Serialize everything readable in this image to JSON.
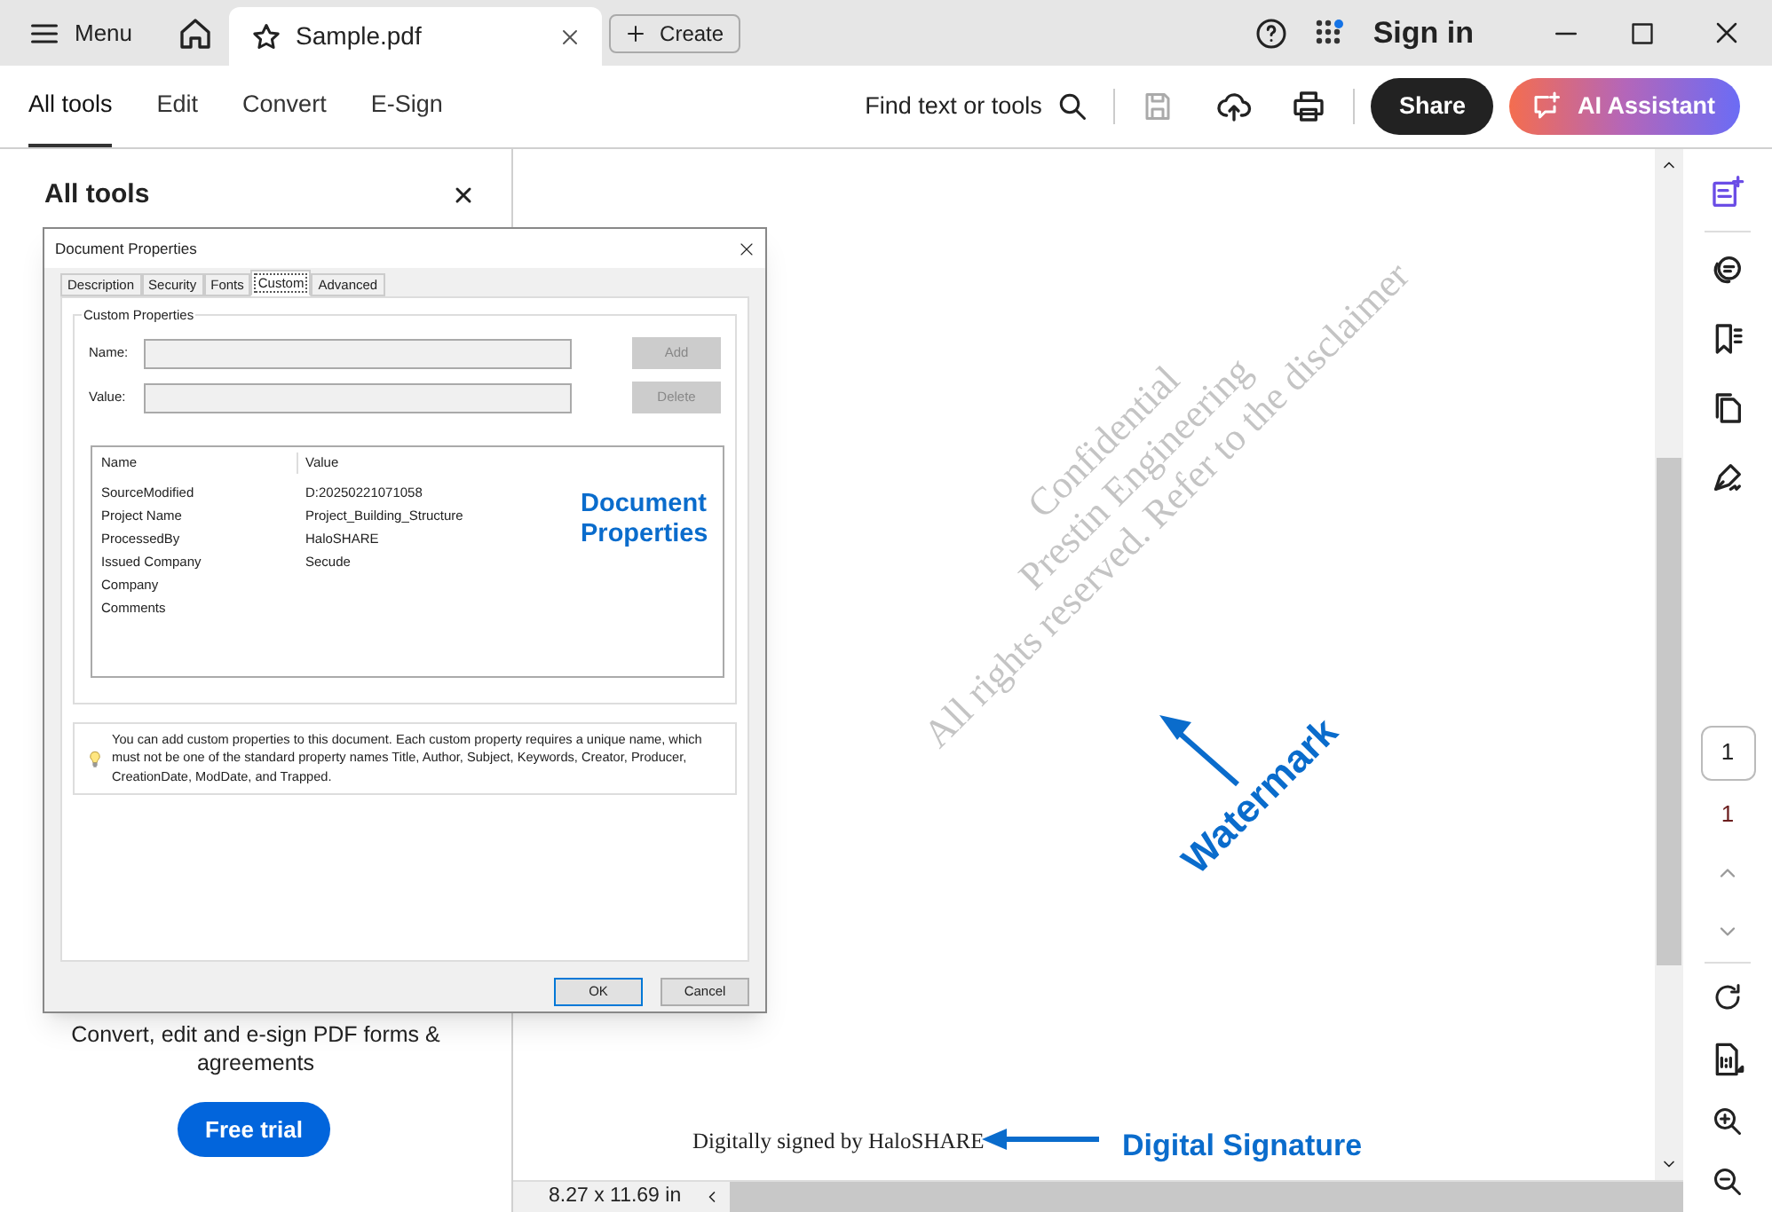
{
  "title_bar": {
    "menu_label": "Menu",
    "tab": {
      "title": "Sample.pdf",
      "selected": true
    },
    "create_label": "Create",
    "sign_in": "Sign in"
  },
  "toolbar": {
    "tabs": [
      {
        "label": "All tools",
        "selected": true
      },
      {
        "label": "Edit",
        "selected": false
      },
      {
        "label": "Convert",
        "selected": false
      },
      {
        "label": "E-Sign",
        "selected": false
      }
    ],
    "search_label": "Find text or tools",
    "save_disabled": true,
    "share_label": "Share",
    "ai_label": "AI Assistant"
  },
  "left_panel": {
    "title": "All tools",
    "promo": "Convert, edit and e-sign PDF forms & agreements",
    "button": "Free trial"
  },
  "dialog": {
    "title": "Document Properties",
    "tabs": [
      {
        "label": "Description",
        "selected": false
      },
      {
        "label": "Security",
        "selected": false
      },
      {
        "label": "Fonts",
        "selected": false
      },
      {
        "label": "Custom",
        "selected": true
      },
      {
        "label": "Advanced",
        "selected": false
      }
    ],
    "group_title": "Custom Properties",
    "name_label": "Name:",
    "value_label": "Value:",
    "add": "Add",
    "delete": "Delete",
    "buttons_disabled": true,
    "list": {
      "columns": [
        "Name",
        "Value"
      ],
      "rows": [
        {
          "name": "SourceModified",
          "value": "D:20250221071058"
        },
        {
          "name": "Project Name",
          "value": "Project_Building_Structure"
        },
        {
          "name": "ProcessedBy",
          "value": "HaloSHARE"
        },
        {
          "name": "Issued Company",
          "value": "Secude"
        },
        {
          "name": "Company"
        },
        {
          "name": "Comments"
        }
      ]
    },
    "info": "You can add custom properties to this document. Each custom property requires a unique name, which must not be one of the standard property names Title, Author, Subject, Keywords, Creator, Producer, CreationDate, ModDate, and Trapped.",
    "ok": "OK",
    "cancel": "Cancel"
  },
  "page": {
    "watermark_lines": [
      "Confidential",
      "Prestin Engineering",
      "All rights reserved. Refer to the disclaimer"
    ],
    "signature": "Digitally signed by HaloSHARE"
  },
  "annotations": {
    "document_properties": "Document Properties",
    "watermark": "Watermark",
    "digital_signature": "Digital Signature"
  },
  "page_nav": {
    "current": "1",
    "total": "1"
  },
  "status": {
    "size": "8.27 x 11.69 in"
  }
}
